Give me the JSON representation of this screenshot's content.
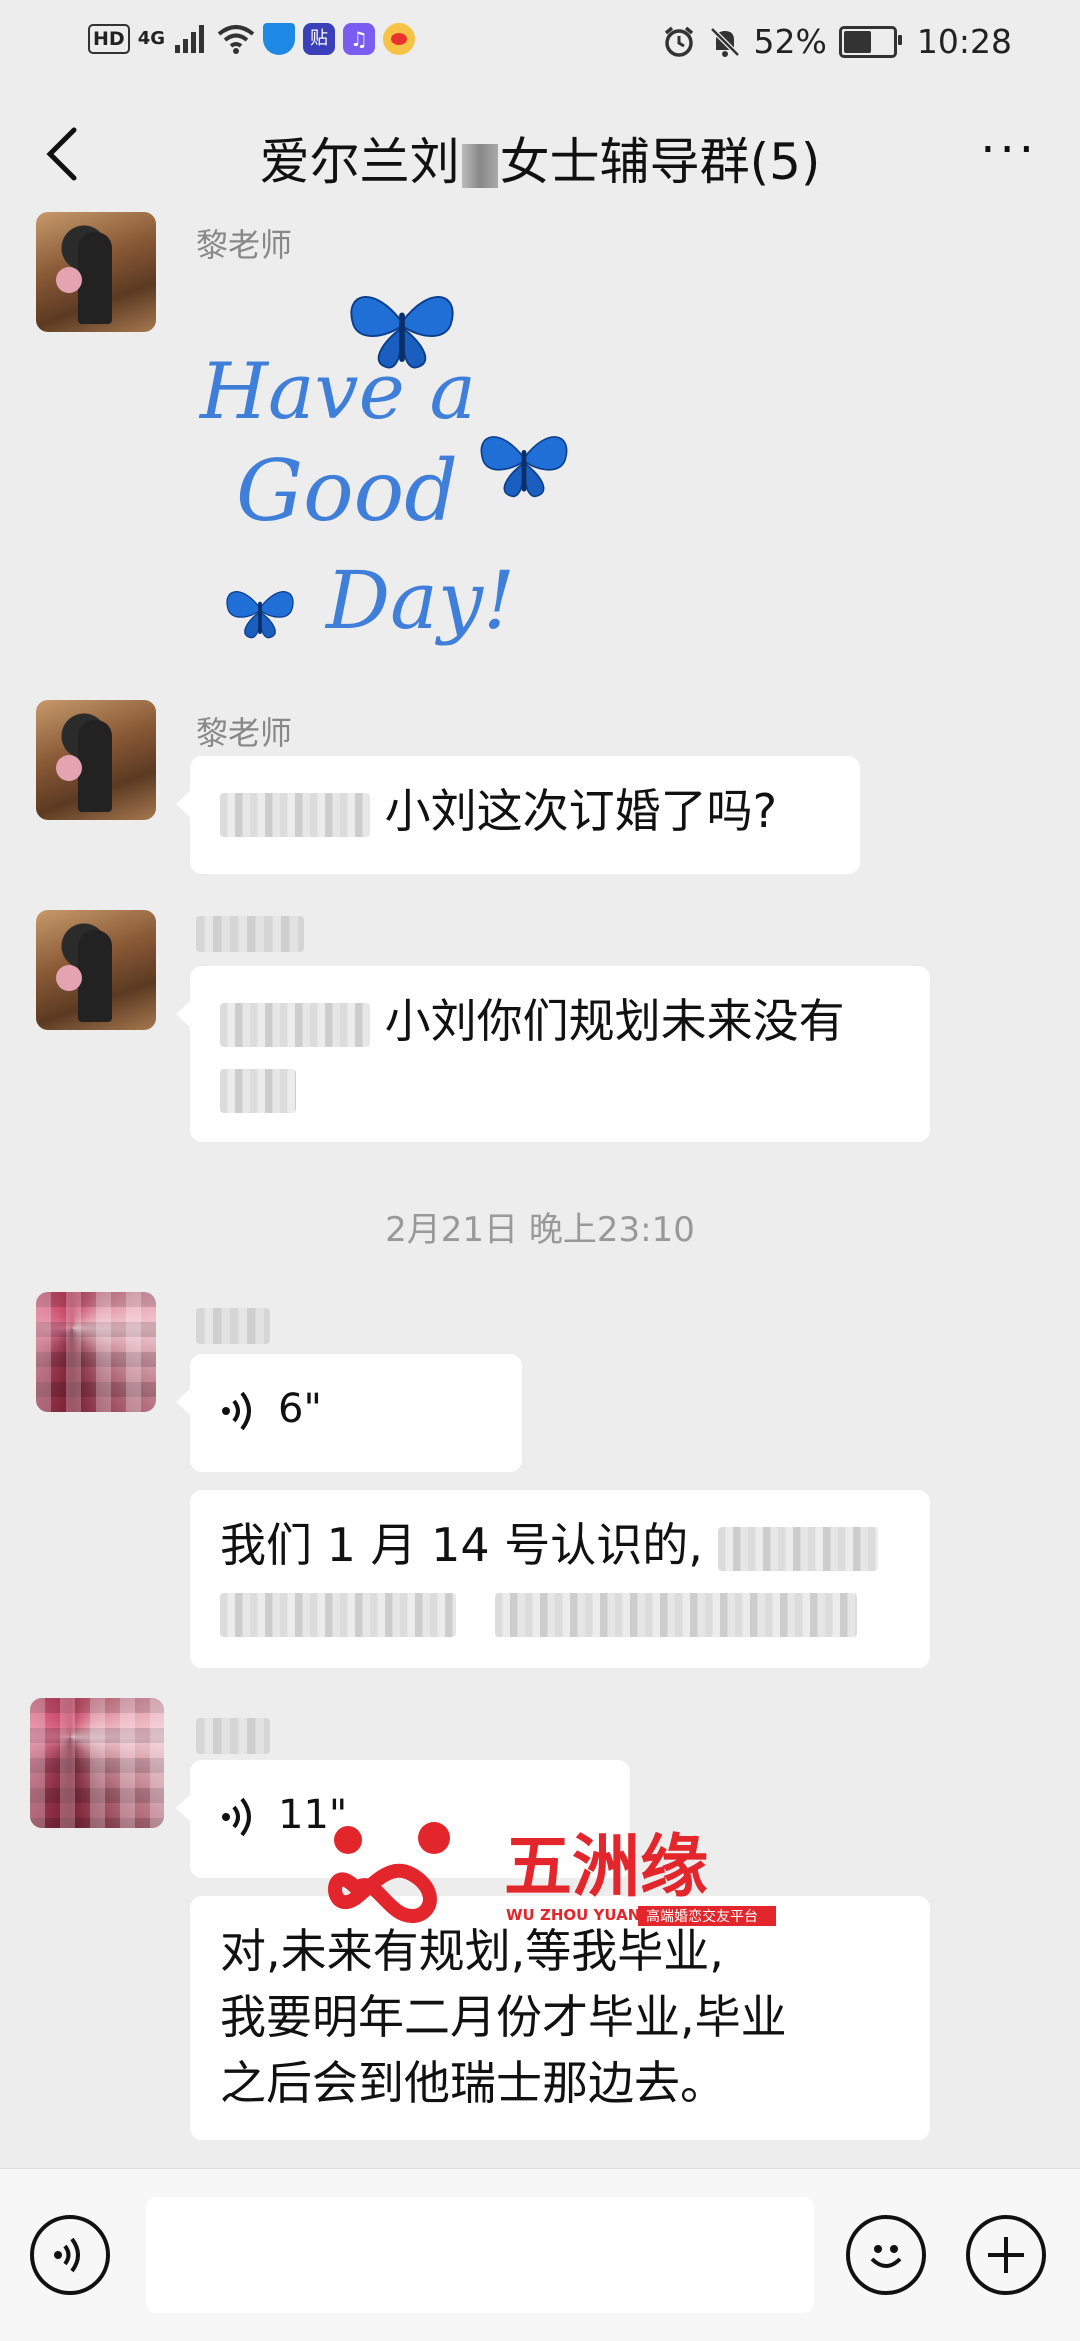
{
  "status_bar": {
    "hd": "HD",
    "network": "4G",
    "battery": "52%",
    "battery_level": 0.52,
    "time": "10:28"
  },
  "header": {
    "title_prefix": "爱尔兰刘",
    "title_suffix": "女士辅导群(5)",
    "more": "···"
  },
  "messages": [
    {
      "sender": "黎老师",
      "type": "sticker",
      "sticker_text": [
        "Have a",
        "Good",
        "Day!"
      ]
    },
    {
      "sender": "黎老师",
      "type": "text",
      "text": "小刘这次订婚了吗?"
    },
    {
      "sender": "",
      "type": "text",
      "text": "小刘你们规划未来没有"
    },
    {
      "type": "timestamp",
      "text": "2月21日 晚上23:10"
    },
    {
      "sender": "",
      "type": "voice",
      "duration": "6\""
    },
    {
      "sender": "",
      "type": "text",
      "text": "我们 1 月 14 号认识的,"
    },
    {
      "sender": "",
      "type": "voice",
      "duration": "11\""
    },
    {
      "sender": "",
      "type": "text",
      "lines": [
        "对,未来有规划,等我毕业,",
        "我要明年二月份才毕业,毕业",
        "之后会到他瑞士那边去。"
      ]
    }
  ],
  "watermark": {
    "brand": "五洲缘",
    "pinyin": "WU ZHOU YUAN",
    "tagline": "高端婚恋交友平台"
  },
  "colors": {
    "background": "#ededed",
    "bubble": "#ffffff",
    "watermark_red": "#e3262b",
    "sticker_blue": "#1f6fd6"
  }
}
